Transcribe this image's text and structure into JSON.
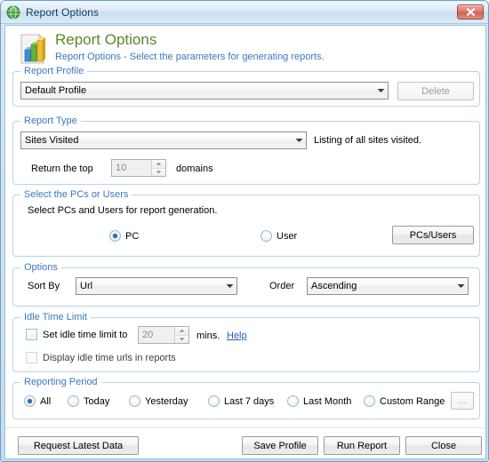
{
  "window": {
    "title": "Report Options",
    "title_icon": "app-globe-icon",
    "close_label": "Close",
    "close_icon": "close-icon"
  },
  "banner": {
    "icon": "bar-chart-report-icon",
    "title": "Report Options",
    "subtitle": "Report Options - Select the parameters for generating reports."
  },
  "colors": {
    "banner_title": "#5c8727",
    "banner_subtitle": "#3a78c2",
    "group_legend": "#3a78c2",
    "group_border": "#b8d4e8",
    "link": "#2a5db0",
    "radio_dot": "#2272bd",
    "close_button": "#cf5f51"
  },
  "report_profile": {
    "legend": "Report Profile",
    "profile_value": "Default Profile",
    "profile_placeholder": "Default Profile",
    "delete_label": "Delete",
    "delete_disabled": true
  },
  "report_type": {
    "legend": "Report Type",
    "type_value": "Sites Visited",
    "description": "Listing of all sites visited.",
    "return_top_label": "Return the top",
    "top_value": "10",
    "domains_label": "domains",
    "top_disabled": true
  },
  "pcs_users": {
    "legend": "Select the PCs or Users",
    "instruction": "Select PCs and Users for report generation.",
    "radio_pc": "PC",
    "radio_user": "User",
    "selected": "PC",
    "button_label": "PCs/Users"
  },
  "options": {
    "legend": "Options",
    "sort_by_label": "Sort By",
    "sort_by_value": "Url",
    "order_label": "Order",
    "order_value": "Ascending"
  },
  "idle_time": {
    "legend": "Idle Time Limit",
    "set_limit_label": "Set idle time limit to",
    "set_limit_checked": false,
    "minutes_value": "20",
    "minutes_unit": "mins.",
    "help_label": "Help",
    "display_urls_label": "Display idle time urls in reports",
    "display_urls_checked": false
  },
  "reporting_period": {
    "legend": "Reporting Period",
    "options": [
      {
        "label": "All",
        "selected": true
      },
      {
        "label": "Today",
        "selected": false
      },
      {
        "label": "Yesterday",
        "selected": false
      },
      {
        "label": "Last 7 days",
        "selected": false
      },
      {
        "label": "Last Month",
        "selected": false
      },
      {
        "label": "Custom Range",
        "selected": false
      }
    ],
    "browse_label": "...",
    "browse_disabled": true
  },
  "footer": {
    "request_latest_data": "Request Latest Data",
    "save_profile": "Save Profile",
    "run_report": "Run Report",
    "close": "Close"
  }
}
